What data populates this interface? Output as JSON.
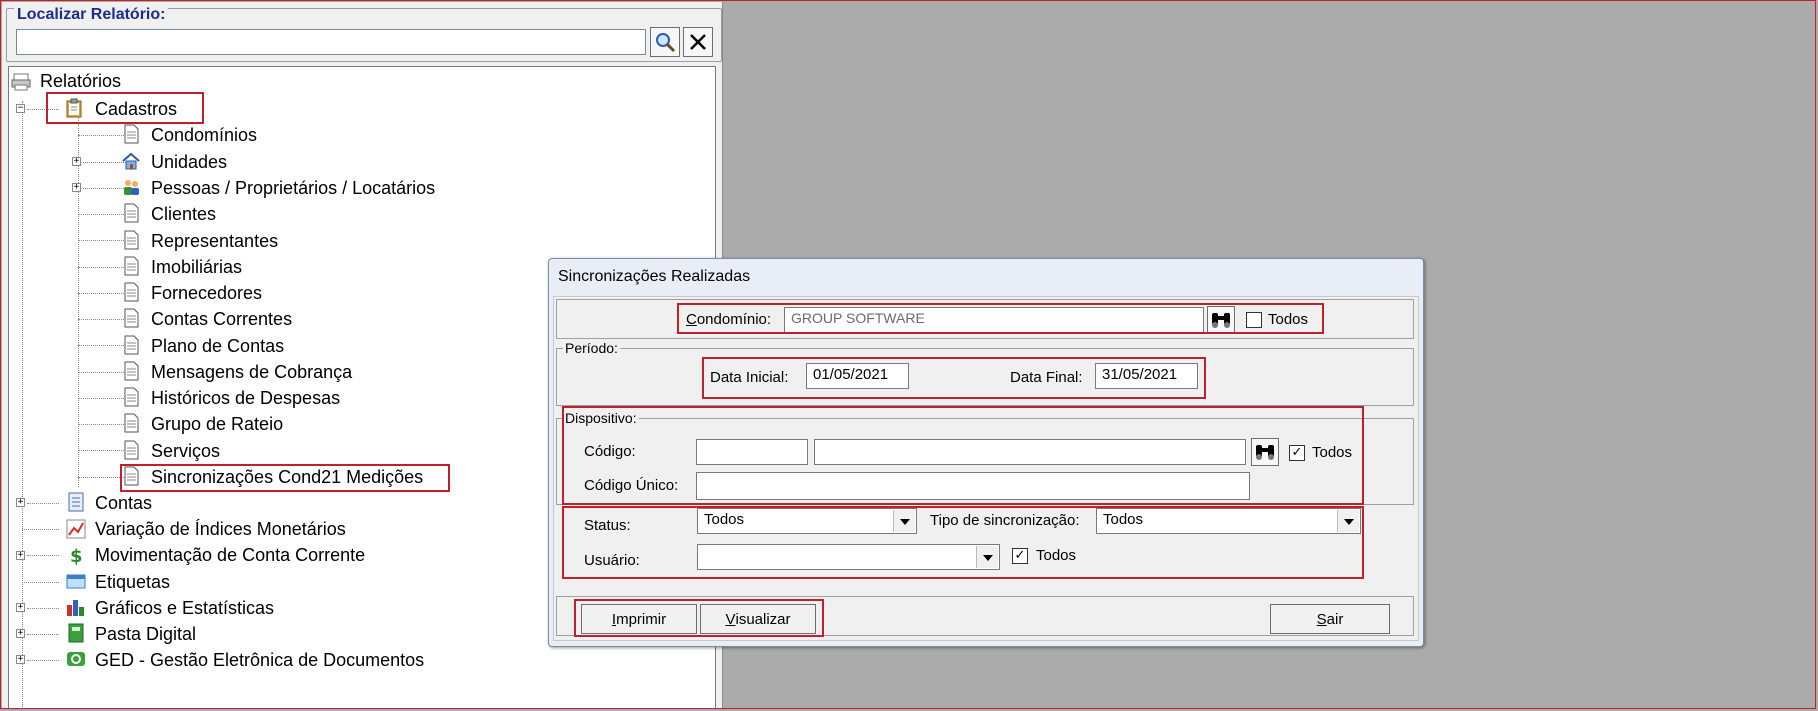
{
  "finder": {
    "legend": "Localizar Relatório:",
    "input_value": "",
    "search_icon": "magnifier-icon",
    "clear_icon": "close-icon"
  },
  "tree": {
    "root": "Relatórios",
    "cadastros": "Cadastros",
    "cadastros_children": [
      "Condomínios",
      "Unidades",
      "Pessoas / Proprietários / Locatários",
      "Clientes",
      "Representantes",
      "Imobiliárias",
      "Fornecedores",
      "Contas Correntes",
      "Plano de Contas",
      "Mensagens de Cobrança",
      "Históricos de Despesas",
      "Grupo de Rateio",
      "Serviços",
      "Sincronizações Cond21 Medições"
    ],
    "others": [
      "Contas",
      "Variação de Índices Monetários",
      "Movimentação de Conta Corrente",
      "Etiquetas",
      "Gráficos e Estatísticas",
      "Pasta Digital",
      "GED - Gestão Eletrônica de Documentos"
    ]
  },
  "dialog": {
    "title": "Sincronizações Realizadas",
    "condominio_label_u": "C",
    "condominio_label_rest": "ondomínio:",
    "condominio_value": "GROUP SOFTWARE",
    "condominio_todos": "Todos",
    "periodo_legend": "Período:",
    "data_inicial_label": "Data Inicial:",
    "data_inicial_value": "01/05/2021",
    "data_final_label": "Data Final:",
    "data_final_value": "31/05/2021",
    "dispositivo_legend": "Dispositivo:",
    "codigo_label": "Código:",
    "codigo_value": "",
    "codigo_desc_value": "",
    "dispositivo_todos": "Todos",
    "codigo_unico_label": "Código Único:",
    "codigo_unico_value": "",
    "status_label": "Status:",
    "status_value": "Todos",
    "tipo_label": "Tipo de sincronização:",
    "tipo_value": "Todos",
    "usuario_label": "Usuário:",
    "usuario_value": "",
    "usuario_todos": "Todos",
    "imprimir_u": "I",
    "imprimir_rest": "mprimir",
    "visualizar_u": "V",
    "visualizar_rest": "isualizar",
    "sair_u": "S",
    "sair_rest": "air"
  },
  "colors": {
    "highlight": "#c0202a",
    "finder_legend": "#1d2c8c",
    "workspace": "#ababab"
  }
}
